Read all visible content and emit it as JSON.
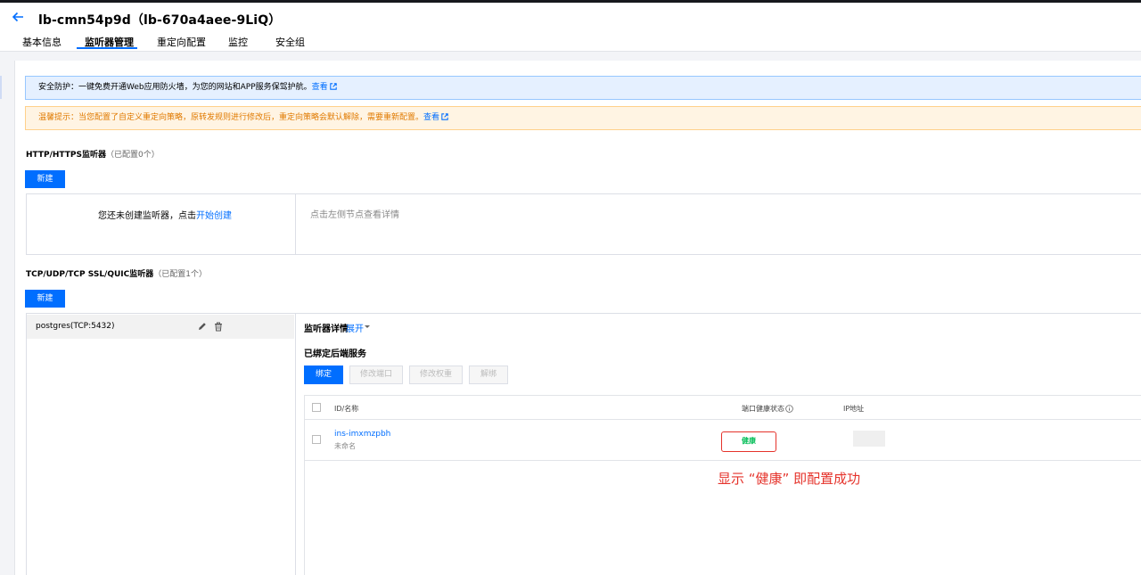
{
  "header": {
    "title": "lb-cmn54p9d（lb-670a4aee-9LiQ）",
    "tabs": [
      {
        "label": "基本信息"
      },
      {
        "label": "监听器管理"
      },
      {
        "label": "重定向配置"
      },
      {
        "label": "监控"
      },
      {
        "label": "安全组"
      }
    ]
  },
  "banners": {
    "security": {
      "text": "安全防护：一键免费开通Web应用防火墙，为您的网站和APP服务保驾护航。",
      "link": "查看"
    },
    "warning": {
      "text": "温馨提示：当您配置了自定义重定向策略，原转发规则进行修改后，重定向策略会默认解除，需要重新配置。",
      "link": "查看"
    }
  },
  "http_section": {
    "title": "HTTP/HTTPS监听器",
    "count": "（已配置0个）",
    "new_button": "新建",
    "empty_text": "您还未创建监听器，点击",
    "empty_link": "开始创建",
    "detail_hint": "点击左侧节点查看详情"
  },
  "tcp_section": {
    "title": "TCP/UDP/TCP SSL/QUIC监听器",
    "count": "（已配置1个）",
    "new_button": "新建",
    "listeners": [
      {
        "label": "postgres(TCP:5432)"
      }
    ]
  },
  "detail": {
    "title": "监听器详情",
    "expand": "展开",
    "bound_title": "已绑定后端服务",
    "buttons": {
      "bind": "绑定",
      "modify_port": "修改端口",
      "modify_weight": "修改权重",
      "unbind": "解绑"
    },
    "table": {
      "columns": {
        "id_name": "ID/名称",
        "health": "端口健康状态",
        "ip": "IP地址"
      },
      "rows": [
        {
          "id": "ins-imxmzpbh",
          "name": "未命名",
          "health": "健康"
        }
      ]
    }
  },
  "annotation": "显示 “健康” 即配置成功",
  "colors": {
    "primary": "#006eff",
    "healthy": "#0abf5b",
    "annotation_red": "#e5332b",
    "warning_text": "#e07a00"
  }
}
